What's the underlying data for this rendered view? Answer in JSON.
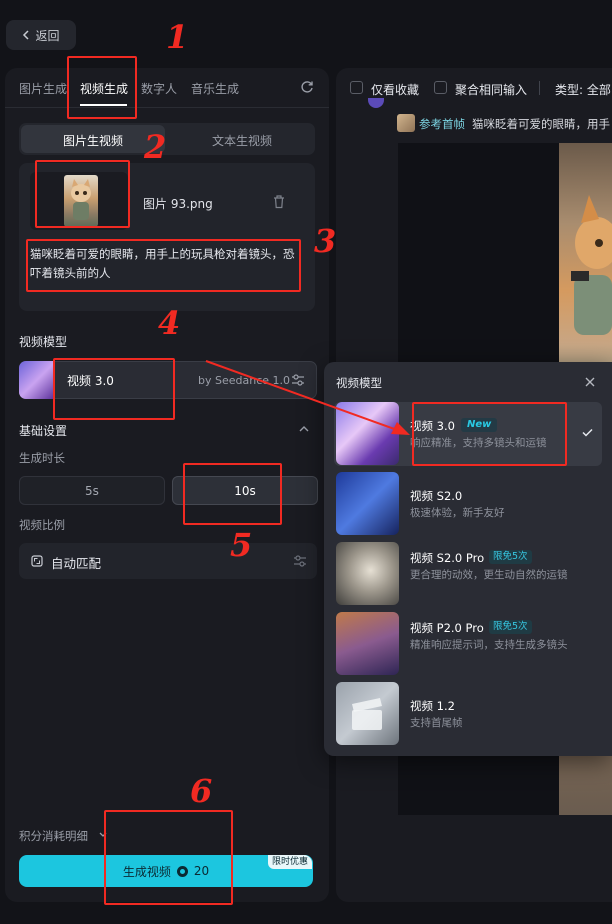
{
  "header": {
    "back_label": "返回"
  },
  "left": {
    "tabs": [
      "图片生成",
      "视频生成",
      "数字人",
      "音乐生成"
    ],
    "mode_tabs": [
      "图片生视频",
      "文本生视频"
    ],
    "upload": {
      "file_name": "图片 93.png"
    },
    "prompt": "猫咪眨着可爱的眼睛，用手上的玩具枪对着镜头，恐吓着镜头前的人",
    "model_section": {
      "title": "视频模型",
      "model_name": "视频 3.0",
      "model_by": "by Seedance 1.0"
    },
    "basic_settings": {
      "title": "基础设置",
      "duration_label": "生成时长",
      "durations": [
        "5s",
        "10s"
      ],
      "ratio_label": "视频比例",
      "ratio_value": "自动匹配"
    },
    "points_label": "积分消耗明细",
    "generate": {
      "label": "生成视频",
      "cost": "20",
      "badge": "限时优惠"
    }
  },
  "right": {
    "filters": {
      "fav_only": "仅看收藏",
      "merge_inputs": "聚合相同输入",
      "type_label": "类型: 全部"
    },
    "ref_label": "参考首帧",
    "ref_text": "猫咪眨着可爱的眼睛，用手"
  },
  "popup": {
    "title": "视频模型",
    "options": [
      {
        "name": "视频 3.0",
        "tag": "New",
        "desc": "响应精准，支持多镜头和运镜"
      },
      {
        "name": "视频 S2.0",
        "tag": "",
        "desc": "极速体验，新手友好"
      },
      {
        "name": "视频 S2.0 Pro",
        "tag": "限免5次",
        "desc": "更合理的动效，更生动自然的运镜"
      },
      {
        "name": "视频 P2.0 Pro",
        "tag": "限免5次",
        "desc": "精准响应提示词，支持生成多镜头"
      },
      {
        "name": "视频 1.2",
        "tag": "",
        "desc": "支持首尾帧"
      }
    ]
  },
  "annotations": [
    "1",
    "2",
    "3",
    "4",
    "5",
    "6"
  ],
  "colors": {
    "accent": "#1cc6df",
    "annotation": "#f12a22",
    "background": "#121318"
  }
}
